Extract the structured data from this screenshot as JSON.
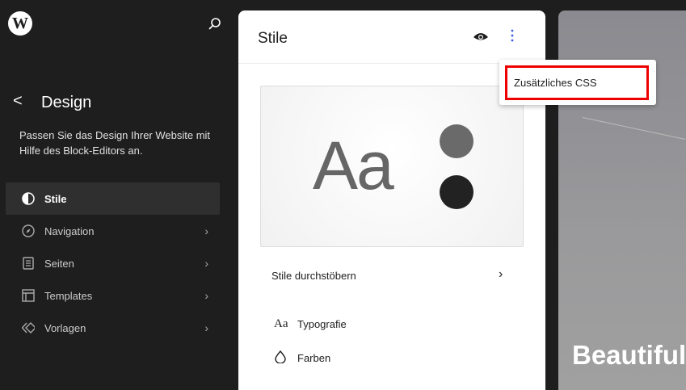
{
  "sidebar": {
    "back_label": "<",
    "title": "Design",
    "description": "Passen Sie das Design Ihrer Website mit Hilfe des Block-Editors an.",
    "items": [
      {
        "label": "Stile",
        "icon": "half-circle-icon"
      },
      {
        "label": "Navigation",
        "icon": "compass-icon"
      },
      {
        "label": "Seiten",
        "icon": "page-icon"
      },
      {
        "label": "Templates",
        "icon": "layout-icon"
      },
      {
        "label": "Vorlagen",
        "icon": "symbol-icon"
      }
    ]
  },
  "panel": {
    "title": "Stile",
    "preview_text": "Aa",
    "preview_colors": [
      "#6a6a6a",
      "#222222"
    ],
    "browse_label": "Stile durchstöbern",
    "typography_icon": "Aa",
    "typography_label": "Typografie",
    "colors_label": "Farben"
  },
  "menu": {
    "item_label": "Zusätzliches CSS",
    "highlight": "#e00000"
  },
  "site_preview": {
    "heading": "Beautiful"
  }
}
